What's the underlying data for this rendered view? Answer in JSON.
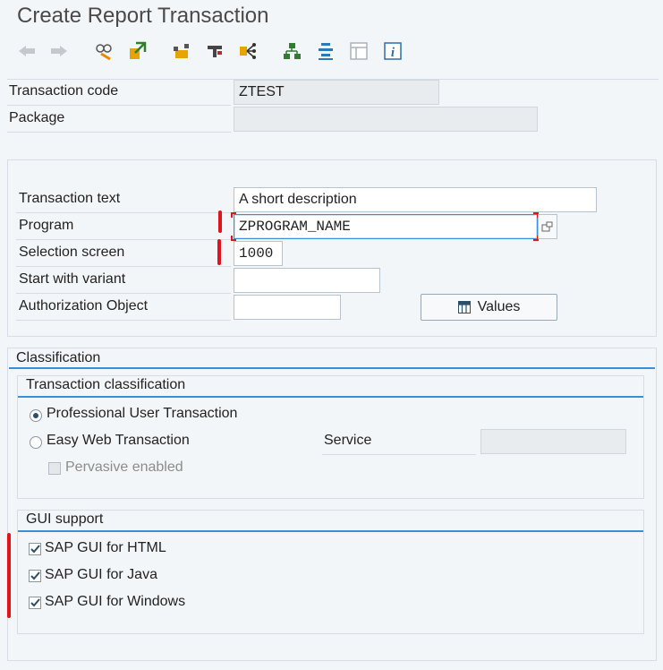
{
  "window": {
    "title": "Create Report Transaction"
  },
  "toolbar": {
    "buttons": [
      "back-icon",
      "forward-icon",
      "display-change-icon",
      "activate-icon",
      "where-used-icon",
      "display-object-list-icon",
      "navigation-icon",
      "hierarchy-icon",
      "outline-icon",
      "layout-icon",
      "info-icon"
    ]
  },
  "header": {
    "transaction_code_label": "Transaction code",
    "transaction_code_value": "ZTEST",
    "package_label": "Package",
    "package_value": ""
  },
  "form": {
    "transaction_text_label": "Transaction text",
    "transaction_text_value": "A short description",
    "program_label": "Program",
    "program_value": "ZPROGRAM_NAME",
    "selection_screen_label": "Selection screen",
    "selection_screen_value": "1000",
    "start_variant_label": "Start with variant",
    "start_variant_value": "",
    "auth_object_label": "Authorization Object",
    "auth_object_value": "",
    "values_button": "Values"
  },
  "classification": {
    "title": "Classification",
    "transaction_classification": {
      "title": "Transaction classification",
      "professional": {
        "label": "Professional User Transaction",
        "checked": true
      },
      "easy_web": {
        "label": "Easy Web Transaction",
        "checked": false
      },
      "service_label": "Service",
      "service_value": "",
      "pervasive": {
        "label": "Pervasive enabled",
        "checked": false,
        "enabled": false
      }
    },
    "gui_support": {
      "title": "GUI support",
      "html": {
        "label": "SAP GUI for HTML",
        "checked": true
      },
      "java": {
        "label": "SAP GUI for Java",
        "checked": true
      },
      "windows": {
        "label": "SAP GUI for Windows",
        "checked": true
      }
    }
  },
  "colors": {
    "accent": "#3c8fd4",
    "highlight_red": "#e3131b"
  }
}
